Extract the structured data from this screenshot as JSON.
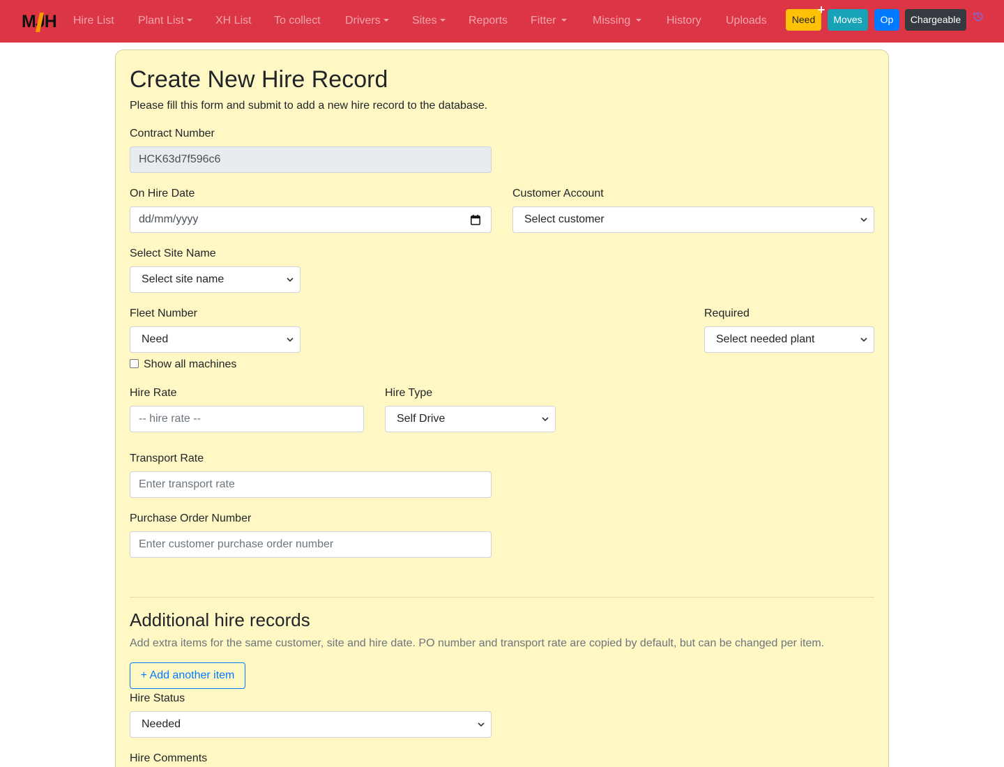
{
  "navbar": {
    "brand": {
      "text": "MJH",
      "colors": {
        "letters": "#111111",
        "swoosh": "#ff9900"
      }
    },
    "background": "#dc3545",
    "items": [
      {
        "label": "Hire List",
        "dropdown": false
      },
      {
        "label": "Plant List",
        "dropdown": true
      },
      {
        "label": "XH List",
        "dropdown": false
      },
      {
        "label": "To collect",
        "dropdown": false
      },
      {
        "label": "Drivers",
        "dropdown": true
      },
      {
        "label": "Sites",
        "dropdown": true
      },
      {
        "label": "Reports",
        "dropdown": false
      },
      {
        "label": "Fitter",
        "dropdown": true
      },
      {
        "label": "Missing",
        "dropdown": true
      },
      {
        "label": "History",
        "dropdown": false
      },
      {
        "label": "Uploads",
        "dropdown": false
      }
    ],
    "buttons": [
      {
        "label": "Need",
        "color": "#ffc107",
        "text_color": "#212529"
      },
      {
        "label": "Moves",
        "color": "#17a2b8",
        "text_color": "#ffffff"
      },
      {
        "label": "Op",
        "color": "#007bff",
        "text_color": "#ffffff"
      },
      {
        "label": "Chargeable",
        "color": "#343a40",
        "text_color": "#ffffff"
      }
    ],
    "icons": {
      "need_badge": "plus-icon",
      "history": "history-icon"
    }
  },
  "form": {
    "title": "Create New Hire Record",
    "intro": "Please fill this form and submit to add a new hire record to the database.",
    "contract_number": {
      "label": "Contract Number",
      "value": "HCK63d7f596c6"
    },
    "on_hire_date": {
      "label": "On Hire Date",
      "placeholder": "dd/mm/yyyy"
    },
    "customer_account": {
      "label": "Customer Account",
      "selected": "Select customer"
    },
    "site_name": {
      "label": "Select Site Name",
      "selected": "Select site name"
    },
    "fleet_number": {
      "label": "Fleet Number",
      "selected": "Need"
    },
    "required": {
      "label": "Required",
      "selected": "Select needed plant"
    },
    "show_all": {
      "label": "Show all machines",
      "checked": false
    },
    "hire_rate": {
      "label": "Hire Rate",
      "placeholder": "-- hire rate --"
    },
    "hire_type": {
      "label": "Hire Type",
      "selected": "Self Drive"
    },
    "transport_rate": {
      "label": "Transport Rate",
      "placeholder": "Enter transport rate"
    },
    "purchase_order": {
      "label": "Purchase Order Number",
      "placeholder": "Enter customer purchase order number"
    },
    "additional": {
      "title": "Additional hire records",
      "description": "Add extra items for the same customer, site and hire date. PO number and transport rate are copied by default, but can be changed per item.",
      "add_button": "+ Add another item"
    },
    "hire_status": {
      "label": "Hire Status",
      "selected": "Needed"
    },
    "hire_comments": {
      "label": "Hire Comments"
    }
  },
  "colors": {
    "card_background": "#fff8c4",
    "accent": "#007bff"
  }
}
